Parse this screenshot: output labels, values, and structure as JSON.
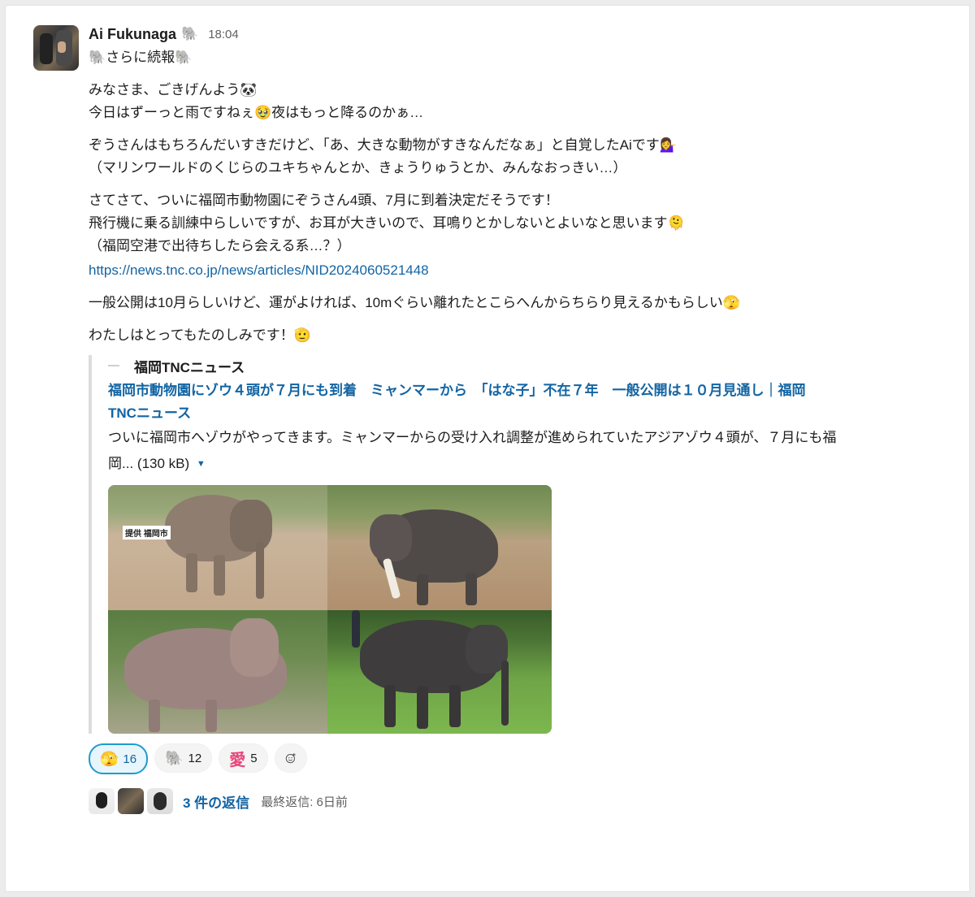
{
  "message": {
    "author": "Ai Fukunaga",
    "author_badge": "🐘",
    "time": "18:04",
    "lines": [
      "🐘さらに続報🐘",
      "みなさま、ごきげんよう🐼",
      "今日はずーっと雨ですねぇ🥹夜はもっと降るのかぁ…",
      "ぞうさんはもちろんだいすきだけど、「あ、大きな動物がすきなんだなぁ」と自覚したAiです💁‍♀️",
      "（マリンワールドのくじらのユキちゃんとか、きょうりゅうとか、みんなおっきい…）",
      "さてさて、ついに福岡市動物園にぞうさん4頭、7月に到着決定だそうです！",
      "飛行機に乗る訓練中らしいですが、お耳が大きいので、耳鳴りとかしないとよいなと思います🫠",
      "（福岡空港で出待ちしたら会える系…？）",
      "一般公開は10月らしいけど、運がよければ、10mぐらい離れたとこらへんからちらり見えるかもらしい🫣",
      "わたしはとってもたのしみです！🫡"
    ],
    "link": "https://news.tnc.co.jp/news/articles/NID2024060521448"
  },
  "unfurl": {
    "source": "福岡TNCニュース",
    "title": "福岡市動物園にゾウ４頭が７月にも到着　ミャンマーから　「はな子」不在７年　一般公開は１０月見通し｜福岡TNCニュース",
    "description": "ついに福岡市へゾウがやってきます。ミャンマーからの受け入れ調整が進められていたアジアゾウ４頭が、７月にも福岡...",
    "size": "(130 kB)",
    "image_caption": "提供 福岡市"
  },
  "reactions": [
    {
      "emoji": "🫣",
      "count": "16",
      "active": true
    },
    {
      "emoji": "🐘",
      "count": "12",
      "active": false
    },
    {
      "emoji": "愛",
      "count": "5",
      "active": false
    }
  ],
  "thread": {
    "reply_count": "3 件の返信",
    "last_reply": "最終返信: 6日前"
  },
  "colors": {
    "link": "#1264a3",
    "active_reaction_border": "#1d9bd1"
  }
}
